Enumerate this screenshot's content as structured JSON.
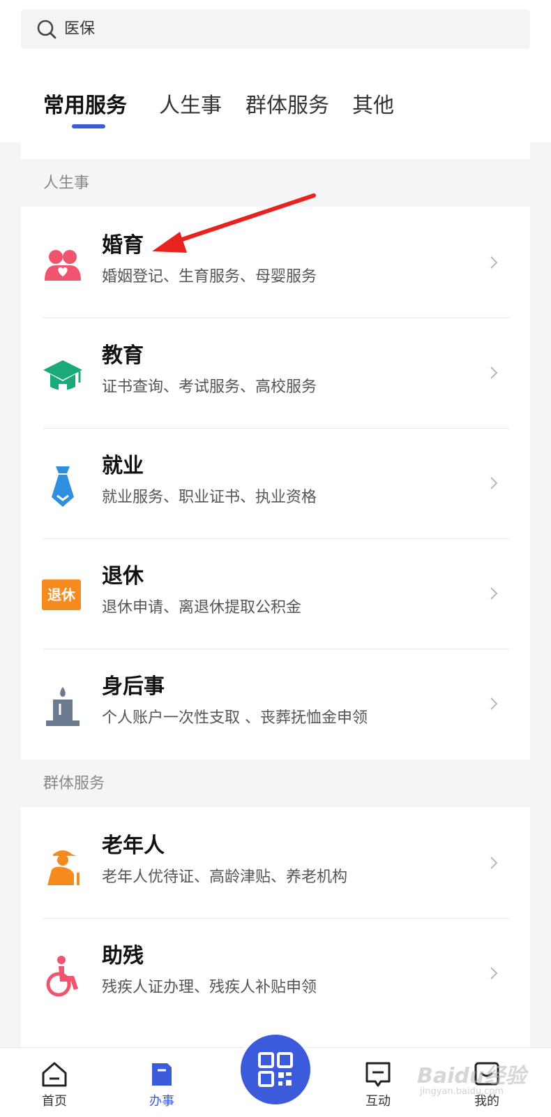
{
  "search": {
    "text": "医保"
  },
  "tabs": [
    {
      "label": "常用服务",
      "active": true
    },
    {
      "label": "人生事",
      "active": false
    },
    {
      "label": "群体服务",
      "active": false
    },
    {
      "label": "其他",
      "active": false
    }
  ],
  "sections": [
    {
      "title": "人生事",
      "items": [
        {
          "title": "婚育",
          "sub": "婚姻登记、生育服务、母婴服务",
          "icon": "couple-heart-icon"
        },
        {
          "title": "教育",
          "sub": "证书查询、考试服务、高校服务",
          "icon": "graduation-cap-icon"
        },
        {
          "title": "就业",
          "sub": "就业服务、职业证书、执业资格",
          "icon": "necktie-icon"
        },
        {
          "title": "退休",
          "sub": "退休申请、离退休提取公积金",
          "icon": "retire-badge-icon",
          "badge": "退休"
        },
        {
          "title": "身后事",
          "sub": "个人账户一次性支取 、丧葬抚恤金申领",
          "icon": "candle-icon"
        }
      ]
    },
    {
      "title": "群体服务",
      "items": [
        {
          "title": "老年人",
          "sub": "老年人优待证、高龄津贴、养老机构",
          "icon": "elderly-icon"
        },
        {
          "title": "助残",
          "sub": "残疾人证办理、残疾人补贴申领",
          "icon": "wheelchair-icon"
        }
      ]
    }
  ],
  "bottom_nav": [
    {
      "label": "首页",
      "icon": "home-icon",
      "active": false
    },
    {
      "label": "办事",
      "icon": "document-icon",
      "active": true
    },
    {
      "label": "互动",
      "icon": "message-icon",
      "active": false
    },
    {
      "label": "我的",
      "icon": "profile-icon",
      "active": false
    }
  ],
  "fab": {
    "icon": "qr-code-icon"
  },
  "watermark": {
    "text": "Baidu经验",
    "sub": "jingyan.baidu.com"
  },
  "colors": {
    "accent": "#3b5bdb",
    "marriage": "#f0546f",
    "education": "#1aaa7a",
    "employment": "#2f8ee0",
    "retire": "#f58a1f",
    "candle": "#6b7a8f",
    "elderly": "#f58a1f",
    "disability": "#f0546f",
    "annotation_arrow": "#e8231f"
  }
}
